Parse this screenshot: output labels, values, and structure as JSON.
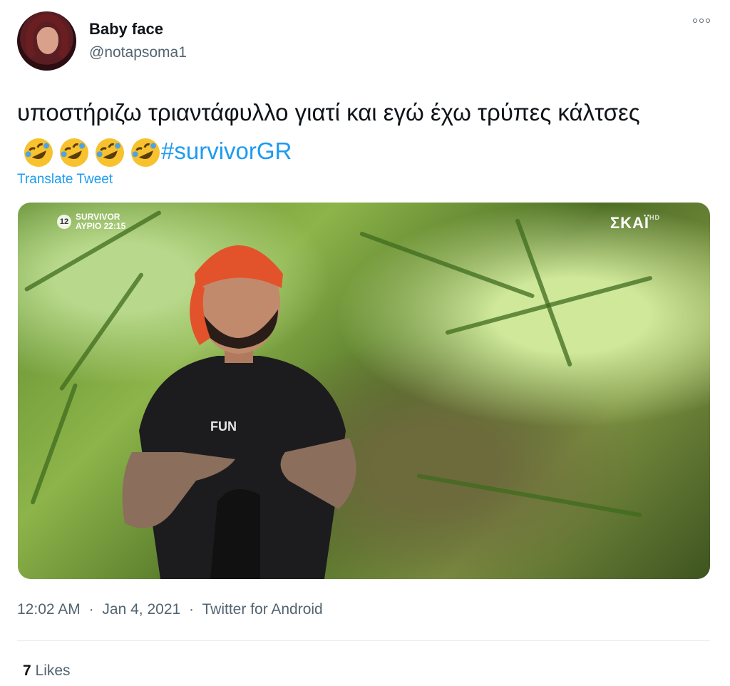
{
  "author": {
    "display_name": "Baby face",
    "handle": "@notapsoma1"
  },
  "tweet": {
    "text": "υποστήριζω τριαντάφυλλο γιατί και εγώ έχω τρύπες κάλτσες",
    "emojis": [
      "rolling-on-floor-laughing",
      "rolling-on-floor-laughing",
      "rolling-on-floor-laughing",
      "rolling-on-floor-laughing"
    ],
    "hashtag": "#survivorGR",
    "translate_label": "Translate Tweet"
  },
  "media": {
    "overlay_show": "SURVIVOR",
    "overlay_schedule": "ΑΥΡΙΟ 22:15",
    "overlay_badge": "12",
    "channel_logo": "ΣΚΑΪ",
    "channel_suffix": "HD",
    "shirt_text": "FUN"
  },
  "meta": {
    "time": "12:02 AM",
    "date": "Jan 4, 2021",
    "source": "Twitter for Android",
    "separator": "·"
  },
  "stats": {
    "likes_count": "7",
    "likes_label": "Likes"
  },
  "colors": {
    "link": "#1d9bf0",
    "secondary_text": "#536471",
    "primary_text": "#0f1419"
  }
}
